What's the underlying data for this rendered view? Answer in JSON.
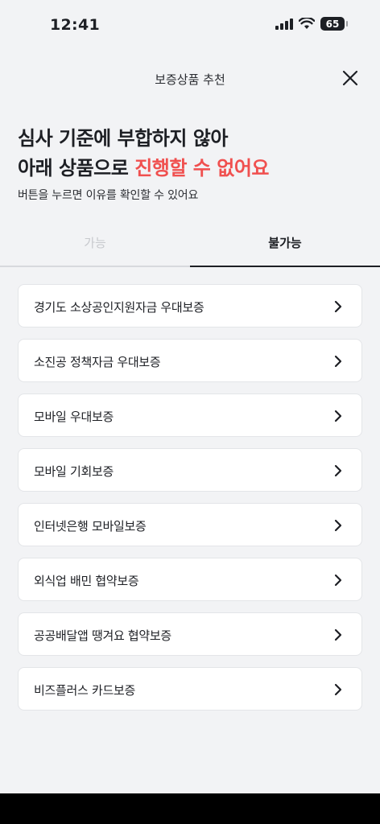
{
  "status_bar": {
    "time": "12:41",
    "battery_level": "65",
    "icons": [
      "cellular-signal-icon",
      "wifi-icon",
      "battery-icon"
    ]
  },
  "header": {
    "title": "보증상품 추천",
    "close_icon": "close-icon"
  },
  "headline": {
    "line1": "심사 기준에 부합하지 않아",
    "line2_prefix": "아래 상품으로 ",
    "line2_accent": "진행할 수 없어요",
    "accent_color": "#f0504f"
  },
  "subtext": "버튼을 누르면 이유를 확인할 수 있어요",
  "tabs": [
    {
      "label": "가능",
      "selected": false
    },
    {
      "label": "불가능",
      "selected": true
    }
  ],
  "products": [
    {
      "label": "경기도 소상공인지원자금 우대보증"
    },
    {
      "label": "소진공 정책자금 우대보증"
    },
    {
      "label": "모바일 우대보증"
    },
    {
      "label": "모바일 기회보증"
    },
    {
      "label": "인터넷은행 모바일보증"
    },
    {
      "label": "외식업 배민 협약보증"
    },
    {
      "label": "공공배달앱 땡겨요 협약보증"
    },
    {
      "label": "비즈플러스 카드보증"
    }
  ]
}
